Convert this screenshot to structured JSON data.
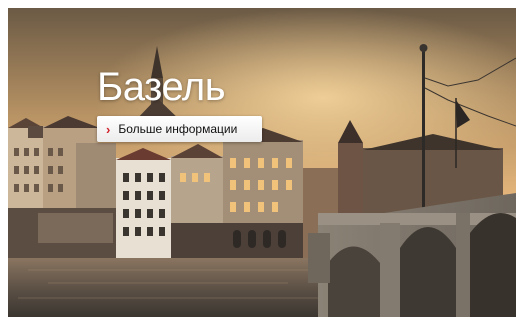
{
  "banner": {
    "title": "Базель",
    "more_button_label": "Больше информации",
    "more_button_icon": "chevron-right-icon",
    "accent_color": "#d0202a"
  }
}
